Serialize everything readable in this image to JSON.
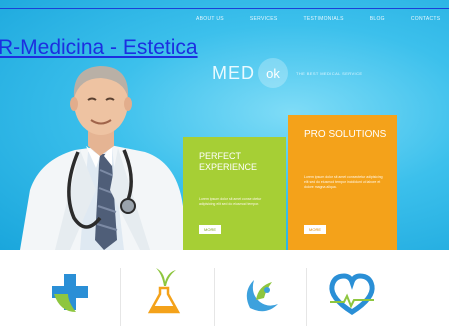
{
  "page": {
    "title_link": "R-Medicina - Estetica"
  },
  "nav": {
    "items": [
      "ABOUT US",
      "SERVICES",
      "TESTIMONIALS",
      "BLOG",
      "CONTACTS"
    ]
  },
  "logo": {
    "text": "MED",
    "badge": "ok",
    "tagline": "THE BEST MEDICAL SERVICE"
  },
  "panels": {
    "green": {
      "title": "PERFECT EXPERIENCE",
      "text": "Lorem ipsum dolor sit amet conse ctetur adipisicing elit sed do eiusmod tempor.",
      "button": "MORE"
    },
    "orange": {
      "title": "PRO SOLUTIONS",
      "text": "Lorem ipsum dolor sit amet consectetur adipisicing elit sed do eiusmod tempor incididunt ut labore et dolore magna aliqua.",
      "button": "MORE"
    }
  },
  "icons": [
    "medical-cross-icon",
    "flask-plant-icon",
    "yin-leaf-icon",
    "heartbeat-heart-icon"
  ],
  "colors": {
    "hero": "#3cc0ec",
    "green_panel": "#a6cf35",
    "orange_panel": "#f4a21a",
    "link": "#1c2fe0"
  }
}
